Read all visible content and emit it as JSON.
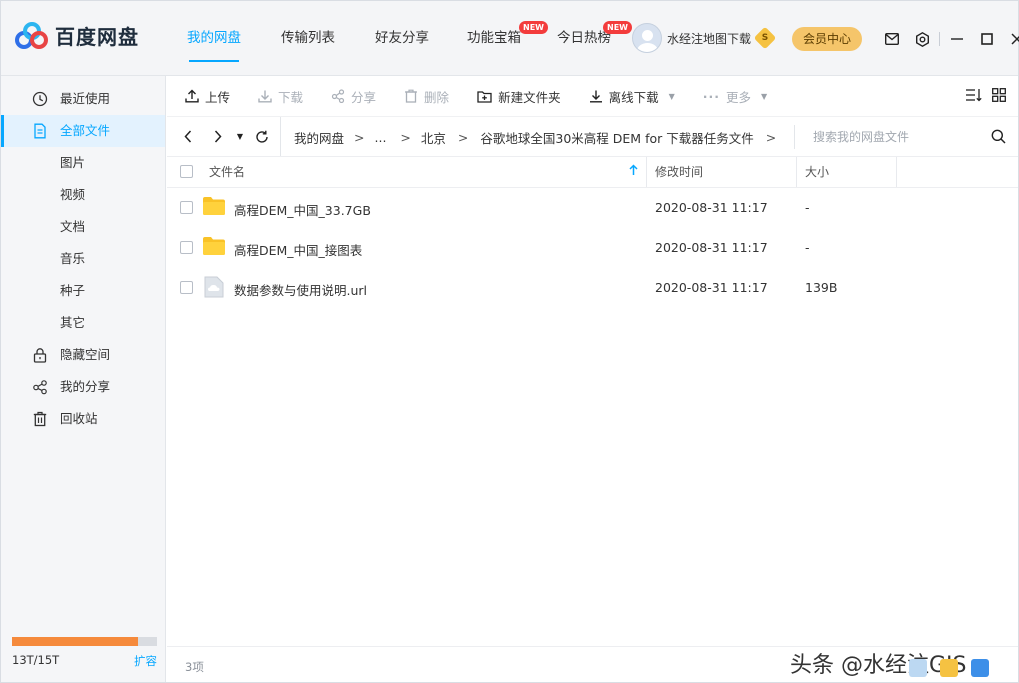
{
  "app": {
    "logo_text": "百度网盘",
    "brand_color": "#06a7ff"
  },
  "nav": {
    "items": [
      {
        "label": "我的网盘",
        "active": true,
        "badge": ""
      },
      {
        "label": "传输列表",
        "active": false,
        "badge": ""
      },
      {
        "label": "好友分享",
        "active": false,
        "badge": ""
      },
      {
        "label": "功能宝箱",
        "active": false,
        "badge": "NEW"
      },
      {
        "label": "今日热榜",
        "active": false,
        "badge": "NEW"
      }
    ]
  },
  "user": {
    "name": "水经注地图下载",
    "vip_mark": "S",
    "member_center_label": "会员中心"
  },
  "window_icons": [
    "mail-icon",
    "settings-icon",
    "minimize-icon",
    "maximize-icon",
    "close-icon"
  ],
  "sidebar": {
    "items": [
      {
        "label": "最近使用",
        "icon": "clock-icon",
        "active": false
      },
      {
        "label": "全部文件",
        "icon": "file-icon",
        "active": true
      },
      {
        "label": "图片",
        "icon": "",
        "active": false
      },
      {
        "label": "视频",
        "icon": "",
        "active": false
      },
      {
        "label": "文档",
        "icon": "",
        "active": false
      },
      {
        "label": "音乐",
        "icon": "",
        "active": false
      },
      {
        "label": "种子",
        "icon": "",
        "active": false
      },
      {
        "label": "其它",
        "icon": "",
        "active": false
      },
      {
        "label": "隐藏空间",
        "icon": "lock-icon",
        "active": false
      },
      {
        "label": "我的分享",
        "icon": "share-icon",
        "active": false
      },
      {
        "label": "回收站",
        "icon": "trash-icon",
        "active": false
      }
    ],
    "storage": {
      "used_label": "13T/15T",
      "used_fraction": 0.8667,
      "expand_label": "扩容"
    }
  },
  "toolbar": {
    "upload": "上传",
    "download": "下载",
    "share": "分享",
    "delete": "删除",
    "new_folder": "新建文件夹",
    "offline_download": "离线下载",
    "more": "更多"
  },
  "path": {
    "crumbs": [
      "我的网盘",
      "...",
      "北京",
      "谷歌地球全国30米高程 DEM for 下载器任务文件"
    ],
    "search_placeholder": "搜索我的网盘文件"
  },
  "table": {
    "headers": {
      "name": "文件名",
      "modified": "修改时间",
      "size": "大小"
    },
    "rows": [
      {
        "name": "高程DEM_中国_33.7GB",
        "type": "folder",
        "modified": "2020-08-31 11:17",
        "size": "-"
      },
      {
        "name": "高程DEM_中国_接图表",
        "type": "folder",
        "modified": "2020-08-31 11:17",
        "size": "-"
      },
      {
        "name": "数据参数与使用说明.url",
        "type": "url",
        "modified": "2020-08-31 11:17",
        "size": "139B"
      }
    ]
  },
  "footer": {
    "count": "3项",
    "watermark": "头条 @水经注GIS"
  }
}
